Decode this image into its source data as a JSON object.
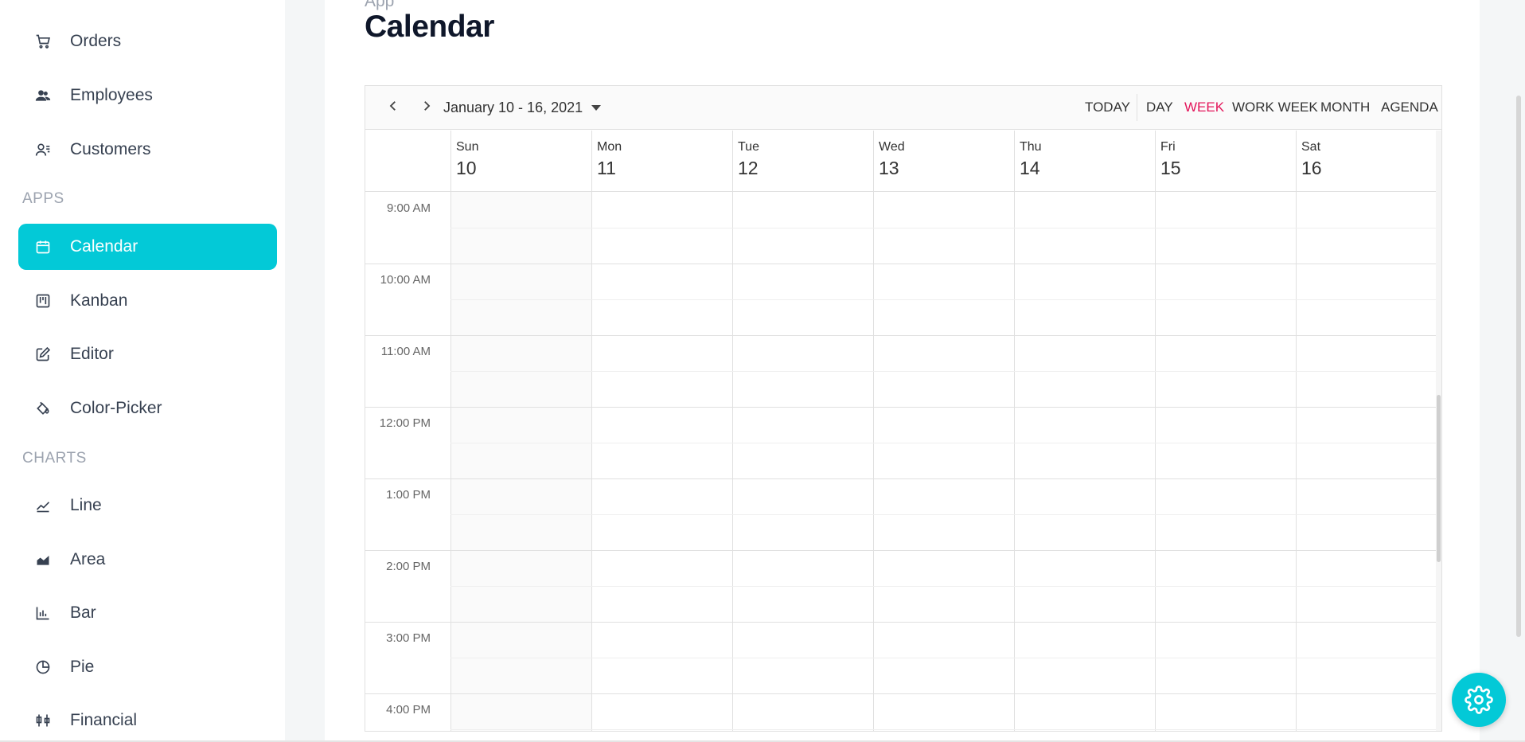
{
  "sidebar": {
    "items_top": [
      {
        "label": "Orders",
        "icon": "cart-icon"
      },
      {
        "label": "Employees",
        "icon": "employees-icon"
      },
      {
        "label": "Customers",
        "icon": "customers-icon"
      }
    ],
    "apps_title": "APPS",
    "apps": [
      {
        "label": "Calendar",
        "icon": "calendar-icon",
        "active": true
      },
      {
        "label": "Kanban",
        "icon": "kanban-icon"
      },
      {
        "label": "Editor",
        "icon": "edit-icon"
      },
      {
        "label": "Color-Picker",
        "icon": "paint-bucket-icon"
      }
    ],
    "charts_title": "CHARTS",
    "charts": [
      {
        "label": "Line",
        "icon": "line-chart-icon"
      },
      {
        "label": "Area",
        "icon": "area-chart-icon"
      },
      {
        "label": "Bar",
        "icon": "bar-chart-icon"
      },
      {
        "label": "Pie",
        "icon": "pie-chart-icon"
      },
      {
        "label": "Financial",
        "icon": "financial-icon"
      }
    ]
  },
  "header": {
    "breadcrumb": "App",
    "title": "Calendar"
  },
  "calendar": {
    "date_range": "January 10 - 16, 2021",
    "views": [
      "TODAY",
      "DAY",
      "WEEK",
      "WORK WEEK",
      "MONTH",
      "AGENDA"
    ],
    "active_view": "WEEK",
    "days": [
      {
        "name": "Sun",
        "num": "10"
      },
      {
        "name": "Mon",
        "num": "11"
      },
      {
        "name": "Tue",
        "num": "12"
      },
      {
        "name": "Wed",
        "num": "13"
      },
      {
        "name": "Thu",
        "num": "14"
      },
      {
        "name": "Fri",
        "num": "15"
      },
      {
        "name": "Sat",
        "num": "16"
      }
    ],
    "times": [
      "9:00 AM",
      "10:00 AM",
      "11:00 AM",
      "12:00 PM",
      "1:00 PM",
      "2:00 PM",
      "3:00 PM",
      "4:00 PM"
    ]
  },
  "colors": {
    "accent": "#03c9d7",
    "active_view": "#e3165b"
  }
}
